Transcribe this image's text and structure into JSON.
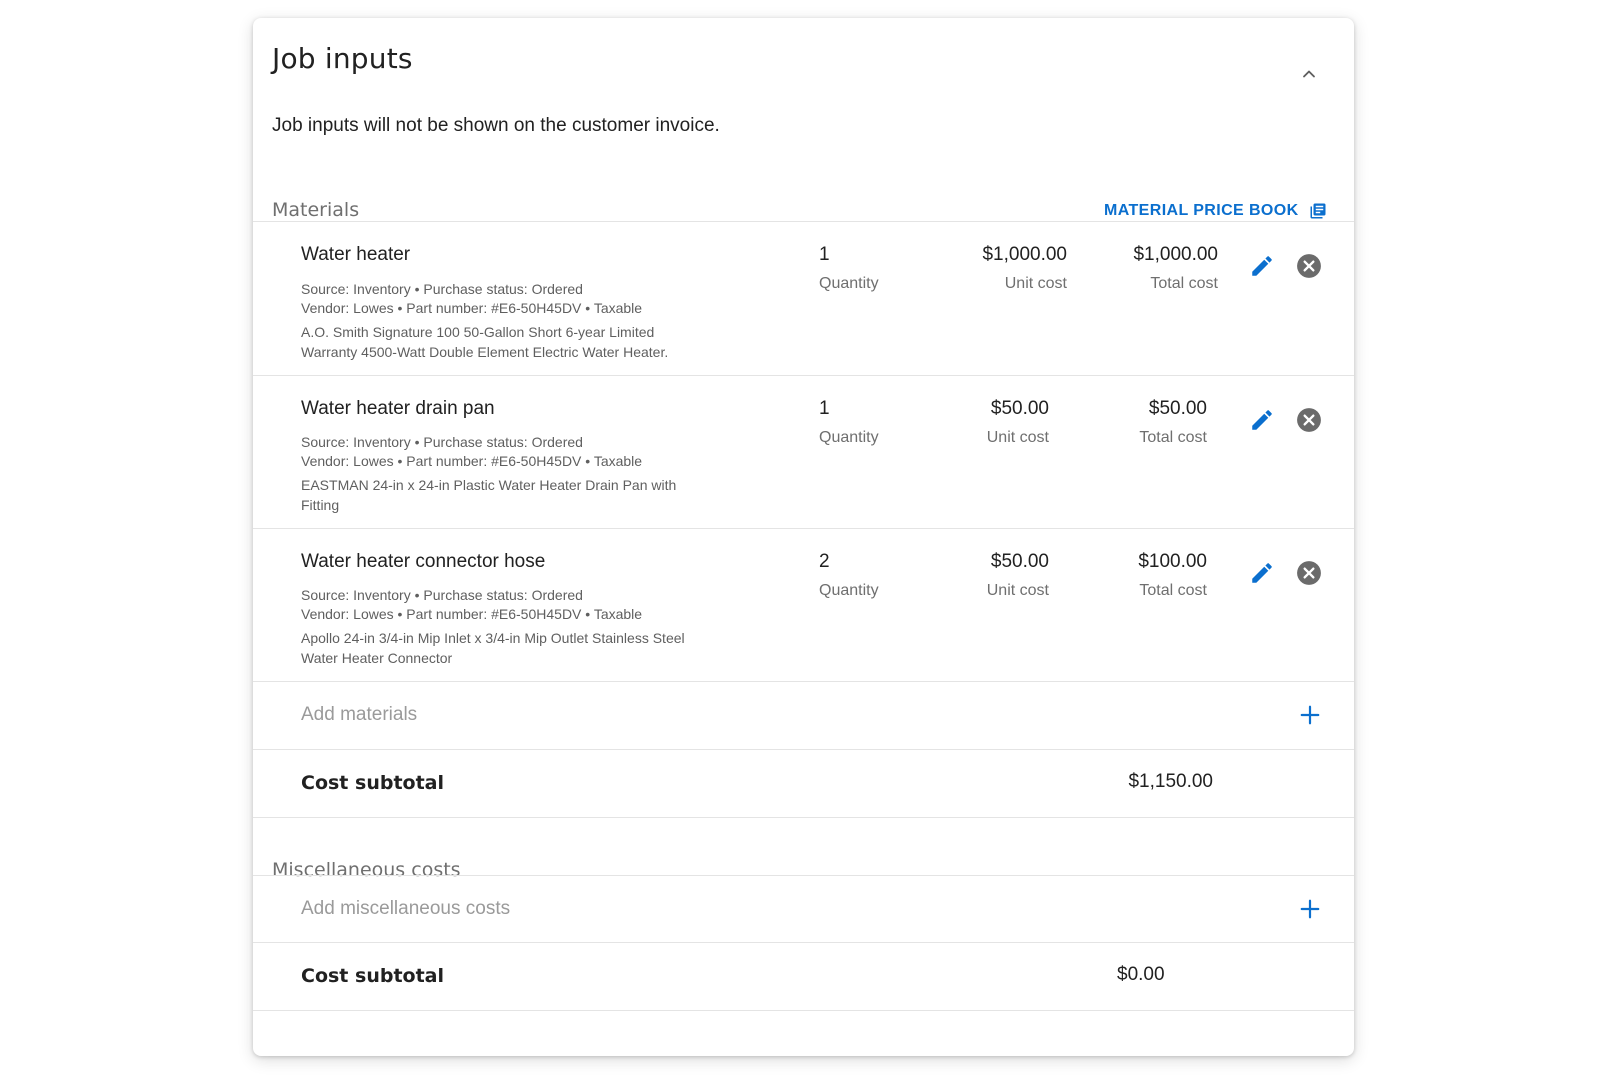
{
  "header": {
    "title": "Job inputs",
    "subtitle": "Job inputs will not be shown on the customer invoice."
  },
  "materials": {
    "section_label": "Materials",
    "price_book_label": "MATERIAL PRICE BOOK",
    "items": [
      {
        "name": "Water heater",
        "meta_line1": "Source: Inventory • Purchase status: Ordered",
        "meta_line2": "Vendor: Lowes • Part number: #E6-50H45DV • Taxable",
        "description": "A.O. Smith  Signature 100 50-Gallon Short 6-year Limited Warranty 4500-Watt Double Element Electric Water Heater.",
        "quantity": "1",
        "quantity_label": "Quantity",
        "unit_cost": "$1,000.00",
        "unit_cost_label": "Unit cost",
        "total_cost": "$1,000.00",
        "total_cost_label": "Total cost"
      },
      {
        "name": "Water heater drain pan",
        "meta_line1": "Source: Inventory • Purchase status: Ordered",
        "meta_line2": "Vendor: Lowes • Part number: #E6-50H45DV • Taxable",
        "description": "EASTMAN  24-in x 24-in Plastic Water Heater Drain Pan with Fitting",
        "quantity": "1",
        "quantity_label": "Quantity",
        "unit_cost": "$50.00",
        "unit_cost_label": "Unit cost",
        "total_cost": "$50.00",
        "total_cost_label": "Total cost"
      },
      {
        "name": "Water heater connector hose",
        "meta_line1": "Source: Inventory • Purchase status: Ordered",
        "meta_line2": "Vendor: Lowes • Part number: #E6-50H45DV • Taxable",
        "description": "Apollo  24-in 3/4-in Mip Inlet x 3/4-in Mip Outlet Stainless Steel Water Heater Connector",
        "quantity": "2",
        "quantity_label": "Quantity",
        "unit_cost": "$50.00",
        "unit_cost_label": "Unit cost",
        "total_cost": "$100.00",
        "total_cost_label": "Total cost"
      }
    ],
    "add_label": "Add materials",
    "subtotal_label": "Cost subtotal",
    "subtotal_value": "$1,150.00"
  },
  "misc": {
    "section_label": "Miscellaneous costs",
    "add_label": "Add miscellaneous costs",
    "subtotal_label": "Cost subtotal",
    "subtotal_value": "$0.00"
  },
  "colors": {
    "accent": "#0b6fce",
    "remove_icon": "#6b6b6b",
    "divider": "#e4e4e4"
  },
  "icons": {
    "collapse": "chevron-up-icon",
    "price_book": "book-icon",
    "edit": "pencil-icon",
    "remove": "close-circle-icon",
    "add": "plus-icon"
  }
}
